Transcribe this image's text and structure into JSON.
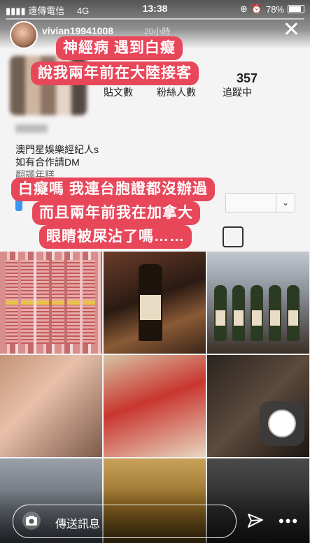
{
  "status_bar": {
    "carrier": "遠傳電信",
    "network": "4G",
    "time": "13:38",
    "battery": "78%",
    "battery_level": 0.78
  },
  "story": {
    "username": "vivian19941008",
    "time_ago": "20小時",
    "close_icon": "close-icon"
  },
  "profile": {
    "posts_label": "貼文數",
    "followers_label": "粉絲人數",
    "following_label": "追蹤中",
    "following_count": "357",
    "bio_lines": [
      "澳門星娛樂經紀人s",
      "如有合作請DM",
      "翻譯年糕"
    ]
  },
  "captions": {
    "line1": "神經病 遇到白癡",
    "line2": "說我兩年前在大陸接客",
    "line3": "白癡嗎 我連台胞證都沒辦過",
    "line4": "而且兩年前我在加拿大",
    "line5": "眼睛被屎沾了嗎……"
  },
  "reply_bar": {
    "placeholder": "傳送訊息",
    "camera_icon": "camera-icon",
    "send_icon": "send-icon",
    "more_icon": "more-icon"
  },
  "colors": {
    "caption_bg": "#e8475a",
    "follow_blue": "#3897f0"
  }
}
